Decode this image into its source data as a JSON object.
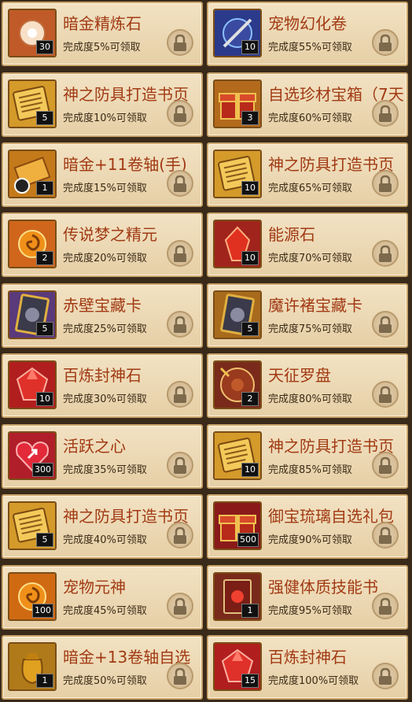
{
  "items": [
    {
      "name": "暗金精炼石",
      "progress": "完成度5%可领取",
      "qty": "30",
      "icon": "flower-stone-icon",
      "theme": "#c05a28"
    },
    {
      "name": "宠物幻化卷",
      "progress": "完成度55%可领取",
      "qty": "10",
      "icon": "sword-orb-icon",
      "theme": "#2b3a8a"
    },
    {
      "name": "神之防具打造书页",
      "progress": "完成度10%可领取",
      "qty": "5",
      "icon": "book-page-icon",
      "theme": "#d49a2a"
    },
    {
      "name": "自选珍材宝箱（7天",
      "progress": "完成度60%可领取",
      "qty": "3",
      "icon": "treasure-chest-icon",
      "theme": "#b36a1c"
    },
    {
      "name": "暗金+11卷轴(手)",
      "progress": "完成度15%可领取",
      "qty": "1",
      "icon": "scroll-icon",
      "theme": "#c47a1a"
    },
    {
      "name": "神之防具打造书页",
      "progress": "完成度65%可领取",
      "qty": "10",
      "icon": "book-page-icon",
      "theme": "#d49a2a"
    },
    {
      "name": "传说梦之精元",
      "progress": "完成度20%可领取",
      "qty": "2",
      "icon": "spiral-orb-icon",
      "theme": "#d0661c"
    },
    {
      "name": "能源石",
      "progress": "完成度70%可领取",
      "qty": "10",
      "icon": "energy-stone-icon",
      "theme": "#a0241c"
    },
    {
      "name": "赤壁宝藏卡",
      "progress": "完成度25%可领取",
      "qty": "5",
      "icon": "treasure-card-icon",
      "theme": "#5a3a7a"
    },
    {
      "name": "魔许褚宝藏卡",
      "progress": "完成度75%可领取",
      "qty": "5",
      "icon": "treasure-card-icon",
      "theme": "#a86a1c"
    },
    {
      "name": "百炼封神石",
      "progress": "完成度30%可领取",
      "qty": "10",
      "icon": "red-gem-icon",
      "theme": "#b01e1e"
    },
    {
      "name": "天征罗盘",
      "progress": "完成度80%可领取",
      "qty": "2",
      "icon": "compass-icon",
      "theme": "#7a2a1a"
    },
    {
      "name": "活跃之心",
      "progress": "完成度35%可领取",
      "qty": "300",
      "icon": "heart-icon",
      "theme": "#b01e2a"
    },
    {
      "name": "神之防具打造书页",
      "progress": "完成度85%可领取",
      "qty": "10",
      "icon": "book-page-icon",
      "theme": "#d49a2a"
    },
    {
      "name": "神之防具打造书页",
      "progress": "完成度40%可领取",
      "qty": "5",
      "icon": "book-page-icon",
      "theme": "#d49a2a"
    },
    {
      "name": "御宝琉璃自选礼包",
      "progress": "完成度90%可领取",
      "qty": "500",
      "icon": "gift-box-icon",
      "theme": "#8a1a1a"
    },
    {
      "name": "宠物元神",
      "progress": "完成度45%可领取",
      "qty": "100",
      "icon": "flame-orb-icon",
      "theme": "#d06a12"
    },
    {
      "name": "强健体质技能书",
      "progress": "完成度95%可领取",
      "qty": "1",
      "icon": "skill-book-icon",
      "theme": "#7a2a1a"
    },
    {
      "name": "暗金+13卷轴自选",
      "progress": "完成度50%可领取",
      "qty": "1",
      "icon": "gold-bag-icon",
      "theme": "#b07a1a"
    },
    {
      "name": "百炼封神石",
      "progress": "完成度100%可领取",
      "qty": "15",
      "icon": "red-gem-icon",
      "theme": "#b01e1e"
    }
  ]
}
